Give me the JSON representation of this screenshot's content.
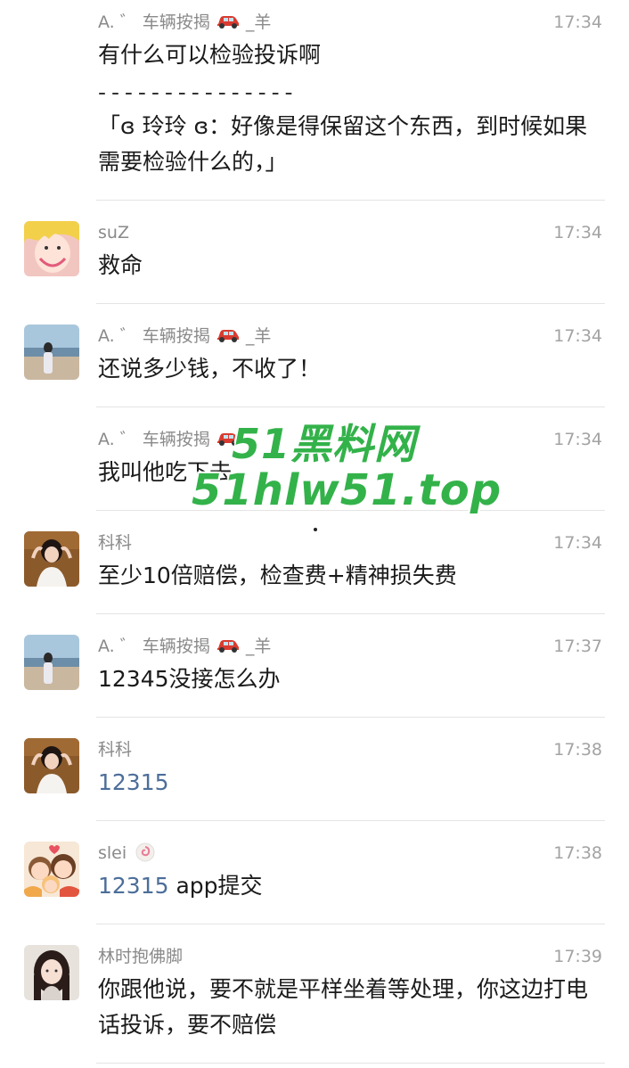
{
  "messages": [
    {
      "sender": "A. ゛ 车辆按揭",
      "sender_suffix": "_羊",
      "time": "17:34",
      "text": "有什么可以检验投诉啊",
      "quote_separator": "- - - - - - - - - - - - - - -",
      "quote": "「ɞ 玲玲 ɞ：好像是得保留这个东西，到时候如果需要检验什么的，」"
    },
    {
      "sender": "suZ",
      "time": "17:34",
      "text": "救命"
    },
    {
      "sender": "A. ゛ 车辆按揭",
      "sender_suffix": "_羊",
      "time": "17:34",
      "text": "还说多少钱，不收了！"
    },
    {
      "sender": "A. ゛ 车辆按揭",
      "time": "17:34",
      "text": "我叫他吃下去"
    },
    {
      "sender": "科科",
      "time": "17:34",
      "text": "至少10倍赔偿，检查费+精神损失费"
    },
    {
      "sender": "A. ゛ 车辆按揭",
      "sender_suffix": "_羊",
      "time": "17:37",
      "text": "12345没接怎么办"
    },
    {
      "sender": "科科",
      "time": "17:38",
      "text_link": "12315"
    },
    {
      "sender": "slei",
      "time": "17:38",
      "text_link": "12315",
      "text_rest": " app提交"
    },
    {
      "sender": "林时抱佛脚",
      "time": "17:39",
      "text": "你跟他说，要不就是平样坐着等处理，你这边打电话投诉，要不赔偿"
    }
  ],
  "watermark": {
    "line1": "51黑料网",
    "line2": "51hlw51.top"
  },
  "icons": {
    "car": "red-car-emoji-icon",
    "cake": "fish-cake-emoji-icon"
  },
  "colors": {
    "sender": "#8a8a8a",
    "time": "#a3a3a3",
    "link": "#4c6e99",
    "watermark": "#33b24a",
    "divider": "#e4e4e4"
  }
}
